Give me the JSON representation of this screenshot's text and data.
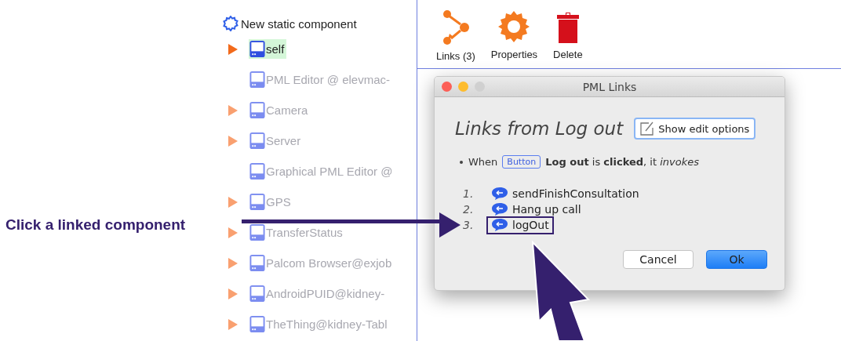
{
  "annotation": {
    "text": "Click a linked component"
  },
  "tree": {
    "label": "New static component",
    "children": [
      {
        "label": "self",
        "expandable": true,
        "selected": true,
        "dimmed": false
      },
      {
        "label": "PML Editor @ elevmac-",
        "expandable": false,
        "selected": false,
        "dimmed": true
      },
      {
        "label": "Camera",
        "expandable": true,
        "selected": false,
        "dimmed": true
      },
      {
        "label": "Server",
        "expandable": true,
        "selected": false,
        "dimmed": true
      },
      {
        "label": "Graphical PML Editor @",
        "expandable": false,
        "selected": false,
        "dimmed": true
      },
      {
        "label": "GPS",
        "expandable": true,
        "selected": false,
        "dimmed": true
      },
      {
        "label": "TransferStatus",
        "expandable": true,
        "selected": false,
        "dimmed": true
      },
      {
        "label": "Palcom Browser@exjob",
        "expandable": true,
        "selected": false,
        "dimmed": true
      },
      {
        "label": "AndroidPUID@kidney-",
        "expandable": true,
        "selected": false,
        "dimmed": true
      },
      {
        "label": "TheThing@kidney-Tabl",
        "expandable": true,
        "selected": false,
        "dimmed": true
      }
    ]
  },
  "toolbar": [
    {
      "kind": "links",
      "label": "Links (3)"
    },
    {
      "kind": "properties",
      "label": "Properties"
    },
    {
      "kind": "delete",
      "label": "Delete"
    }
  ],
  "dialog": {
    "title": "PML Links",
    "heading": "Links from Log out",
    "edit_button": "Show edit options",
    "sentence_start": "When",
    "badge": "Button",
    "sentence_end": "**Log out** is **clicked**, it *invokes*",
    "links": [
      {
        "number": "1.",
        "label": "sendFinishConsultation",
        "highlighted": false
      },
      {
        "number": "2.",
        "label": "Hang up call",
        "highlighted": false
      },
      {
        "number": "3.",
        "label": "logOut",
        "highlighted": true
      }
    ],
    "buttons": [
      {
        "label": "Cancel",
        "default": false
      },
      {
        "label": "Ok",
        "default": true
      }
    ]
  }
}
